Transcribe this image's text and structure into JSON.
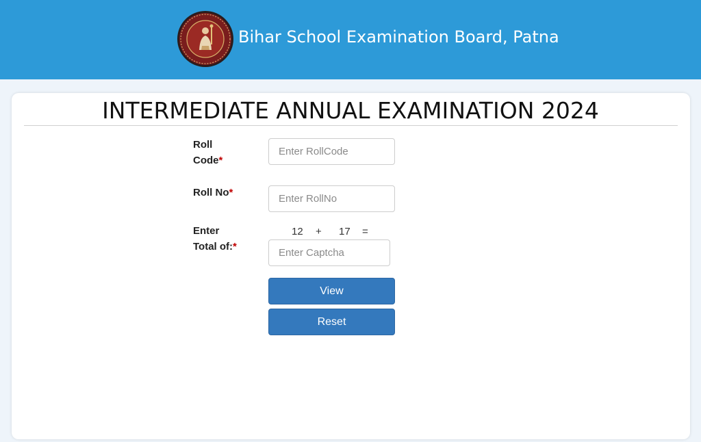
{
  "header": {
    "board_name": "Bihar School Examination Board, Patna",
    "background_color": "#2d9ad8",
    "logo_icon": "bseb-seal-icon"
  },
  "exam": {
    "title": "INTERMEDIATE ANNUAL EXAMINATION 2024"
  },
  "form": {
    "roll_code": {
      "label_line1": "Roll",
      "label_line2": "Code",
      "required_mark": "*",
      "placeholder": "Enter RollCode",
      "value": ""
    },
    "roll_no": {
      "label": "Roll No",
      "required_mark": "*",
      "placeholder": "Enter RollNo",
      "value": ""
    },
    "captcha": {
      "label_line1": "Enter",
      "label_line2": "Total of:",
      "required_mark": "*",
      "operand_a": "12",
      "operator": "+",
      "operand_b": "17",
      "equals": "=",
      "placeholder": "Enter Captcha",
      "value": ""
    },
    "view_button": "View",
    "reset_button": "Reset",
    "button_color": "#3479bd",
    "required_color": "#c00000"
  }
}
